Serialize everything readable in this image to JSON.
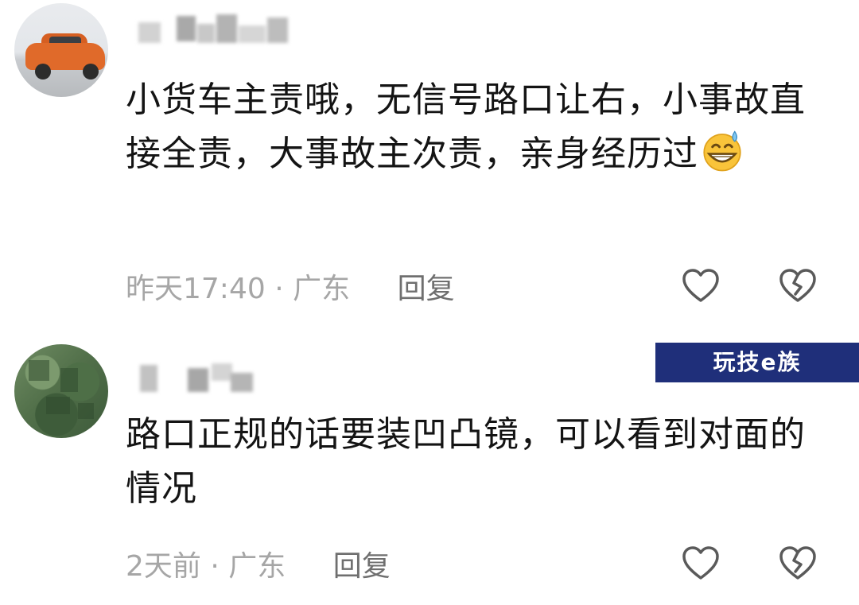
{
  "comments": [
    {
      "text": "小货车主责哦，无信号路口让右，小事故直接全责，大事故主次责，亲身经历过",
      "emoji": "grinning-sweat-emoji",
      "time": "昨天17:40",
      "separator": "·",
      "location": "广东",
      "reply_label": "回复"
    },
    {
      "text": "路口正规的话要装凹凸镜，可以看到对面的情况",
      "time": "2天前",
      "separator": "·",
      "location": "广东",
      "reply_label": "回复"
    }
  ],
  "icons": {
    "like": "heart-outline-icon",
    "dislike": "broken-heart-outline-icon"
  },
  "watermark": {
    "text": "玩技e族",
    "color": "#1f2f7a"
  }
}
